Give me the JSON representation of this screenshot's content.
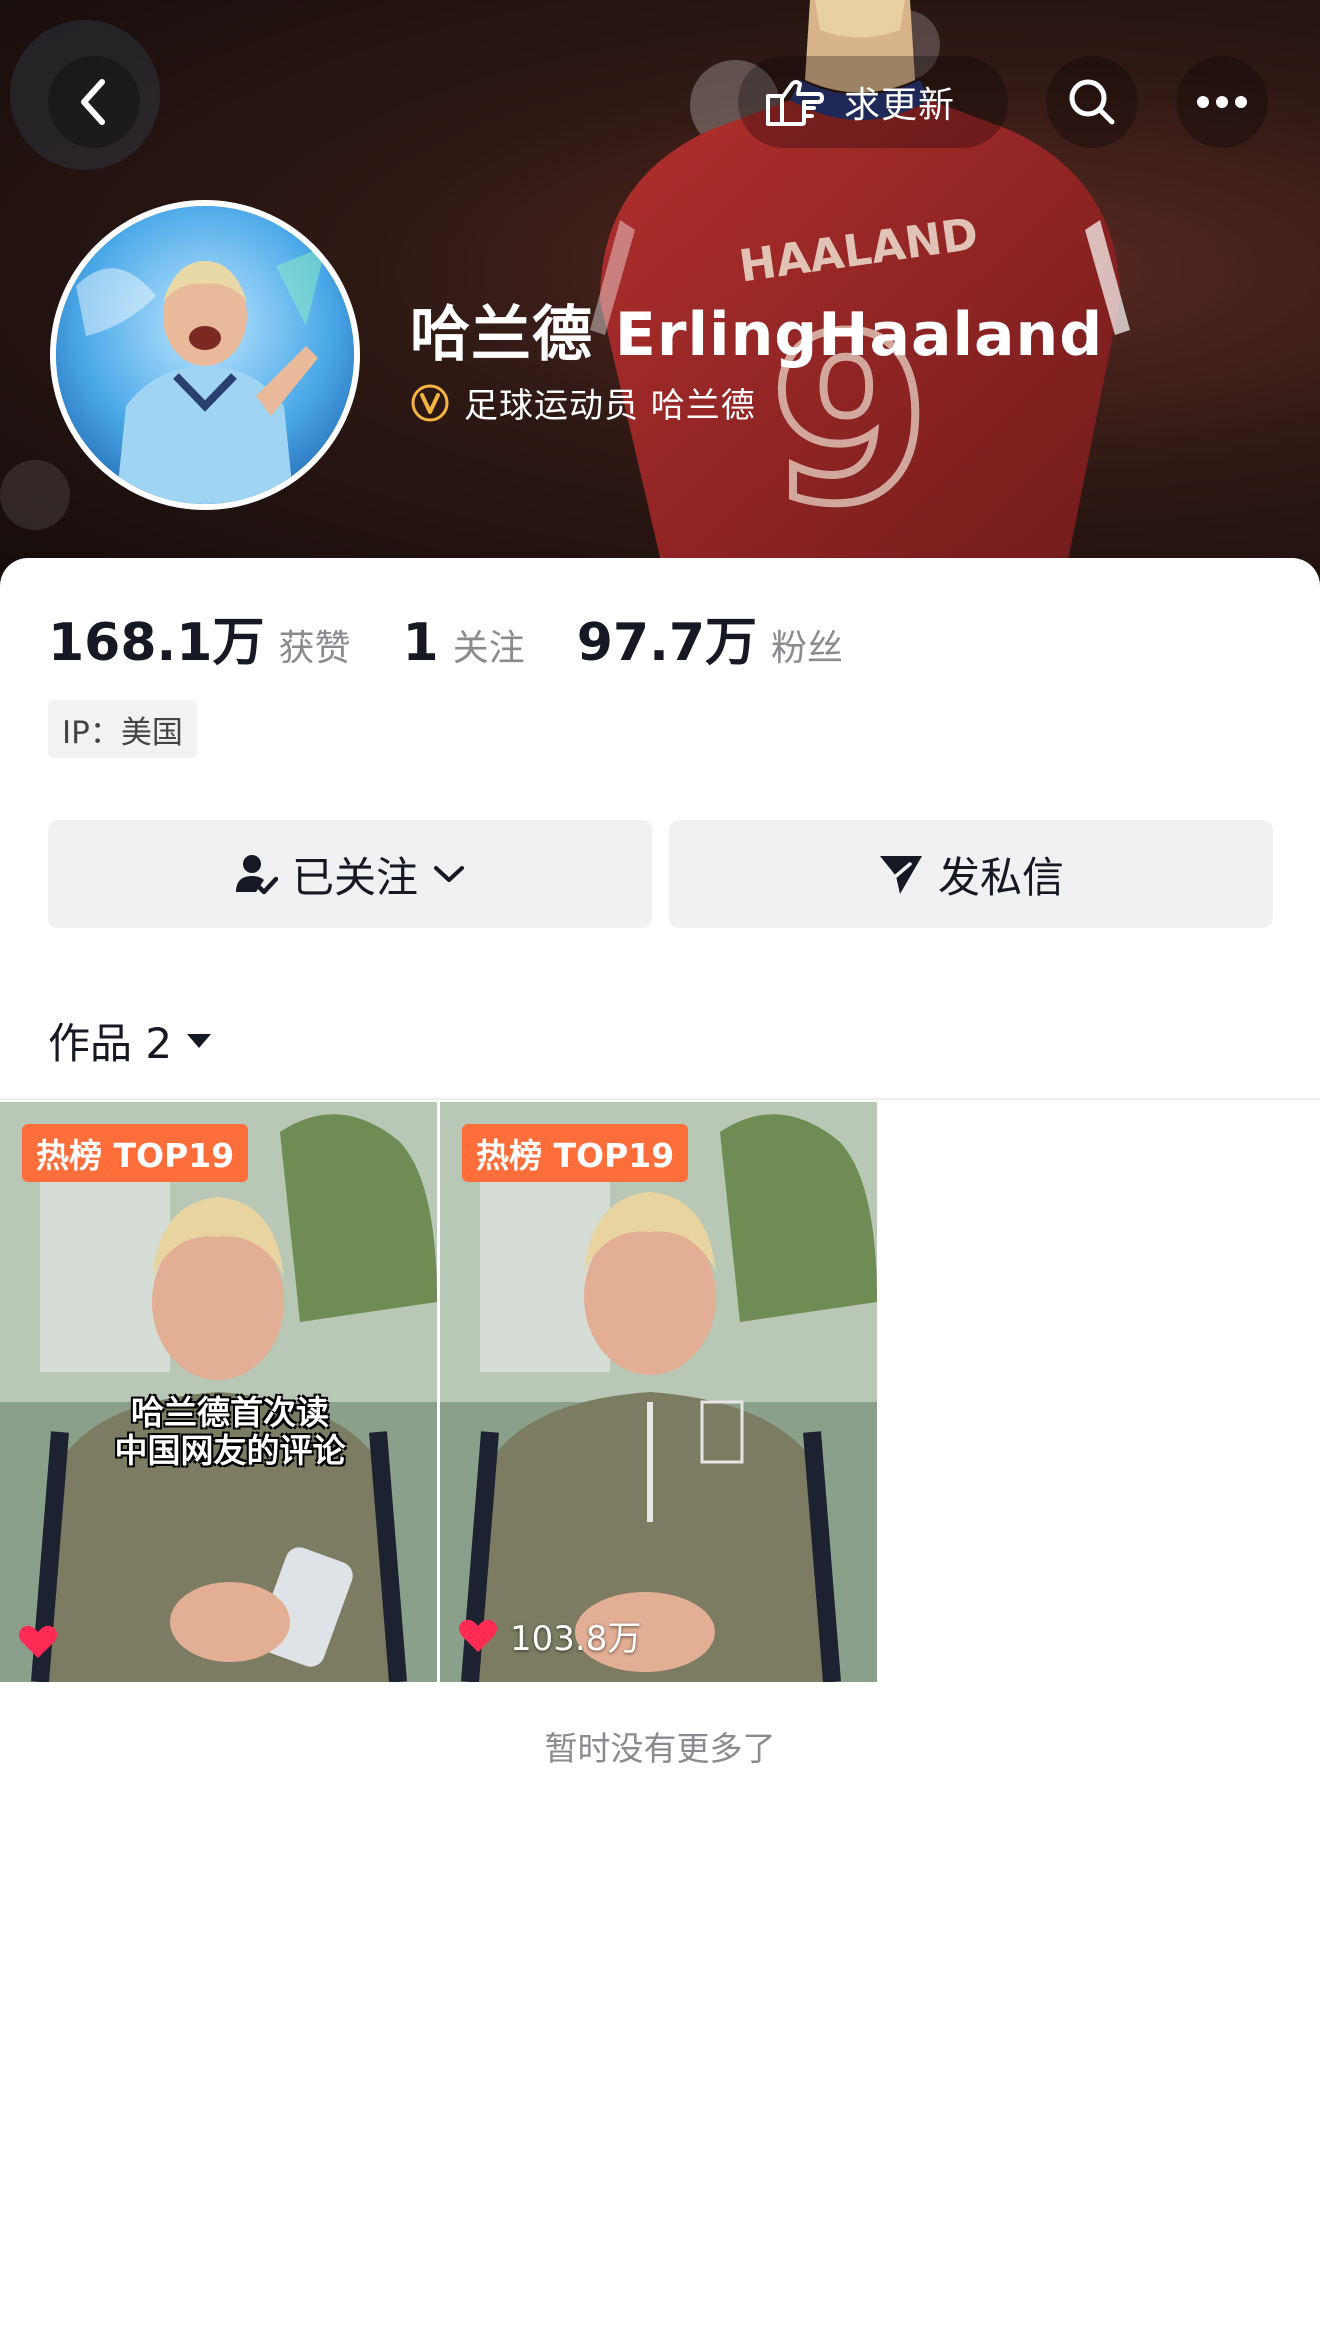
{
  "header": {
    "update_label": "求更新",
    "username": "哈兰德 ErlingHaaland",
    "verify_text": "足球运动员 哈兰德",
    "jersey_name": "HAALAND",
    "jersey_number": "9"
  },
  "stats": [
    {
      "num": "168.1万",
      "label": "获赞"
    },
    {
      "num": "1",
      "label": "关注"
    },
    {
      "num": "97.7万",
      "label": "粉丝"
    }
  ],
  "ip_tag": "IP：美国",
  "actions": {
    "follow_label": "已关注",
    "message_label": "发私信"
  },
  "works_tab": {
    "label": "作品 2"
  },
  "videos": [
    {
      "badge": "热榜 TOP19",
      "caption_line1": "哈兰德首次读",
      "caption_line2": "中国网友的评论",
      "likes": ""
    },
    {
      "badge": "热榜 TOP19",
      "caption_line1": "",
      "caption_line2": "",
      "likes": "103.8万"
    }
  ],
  "footer": {
    "no_more": "暂时没有更多了"
  },
  "colors": {
    "hot_badge": "#fe6e3a",
    "like_heart": "#fe2c55",
    "verify_badge": "#f5b340"
  },
  "icons": [
    "back-arrow-icon",
    "pointing-hand-icon",
    "search-icon",
    "more-dots-icon",
    "verified-badge-icon",
    "followed-user-icon",
    "chevron-down-icon",
    "send-message-icon",
    "dropdown-triangle-icon",
    "heart-icon"
  ]
}
